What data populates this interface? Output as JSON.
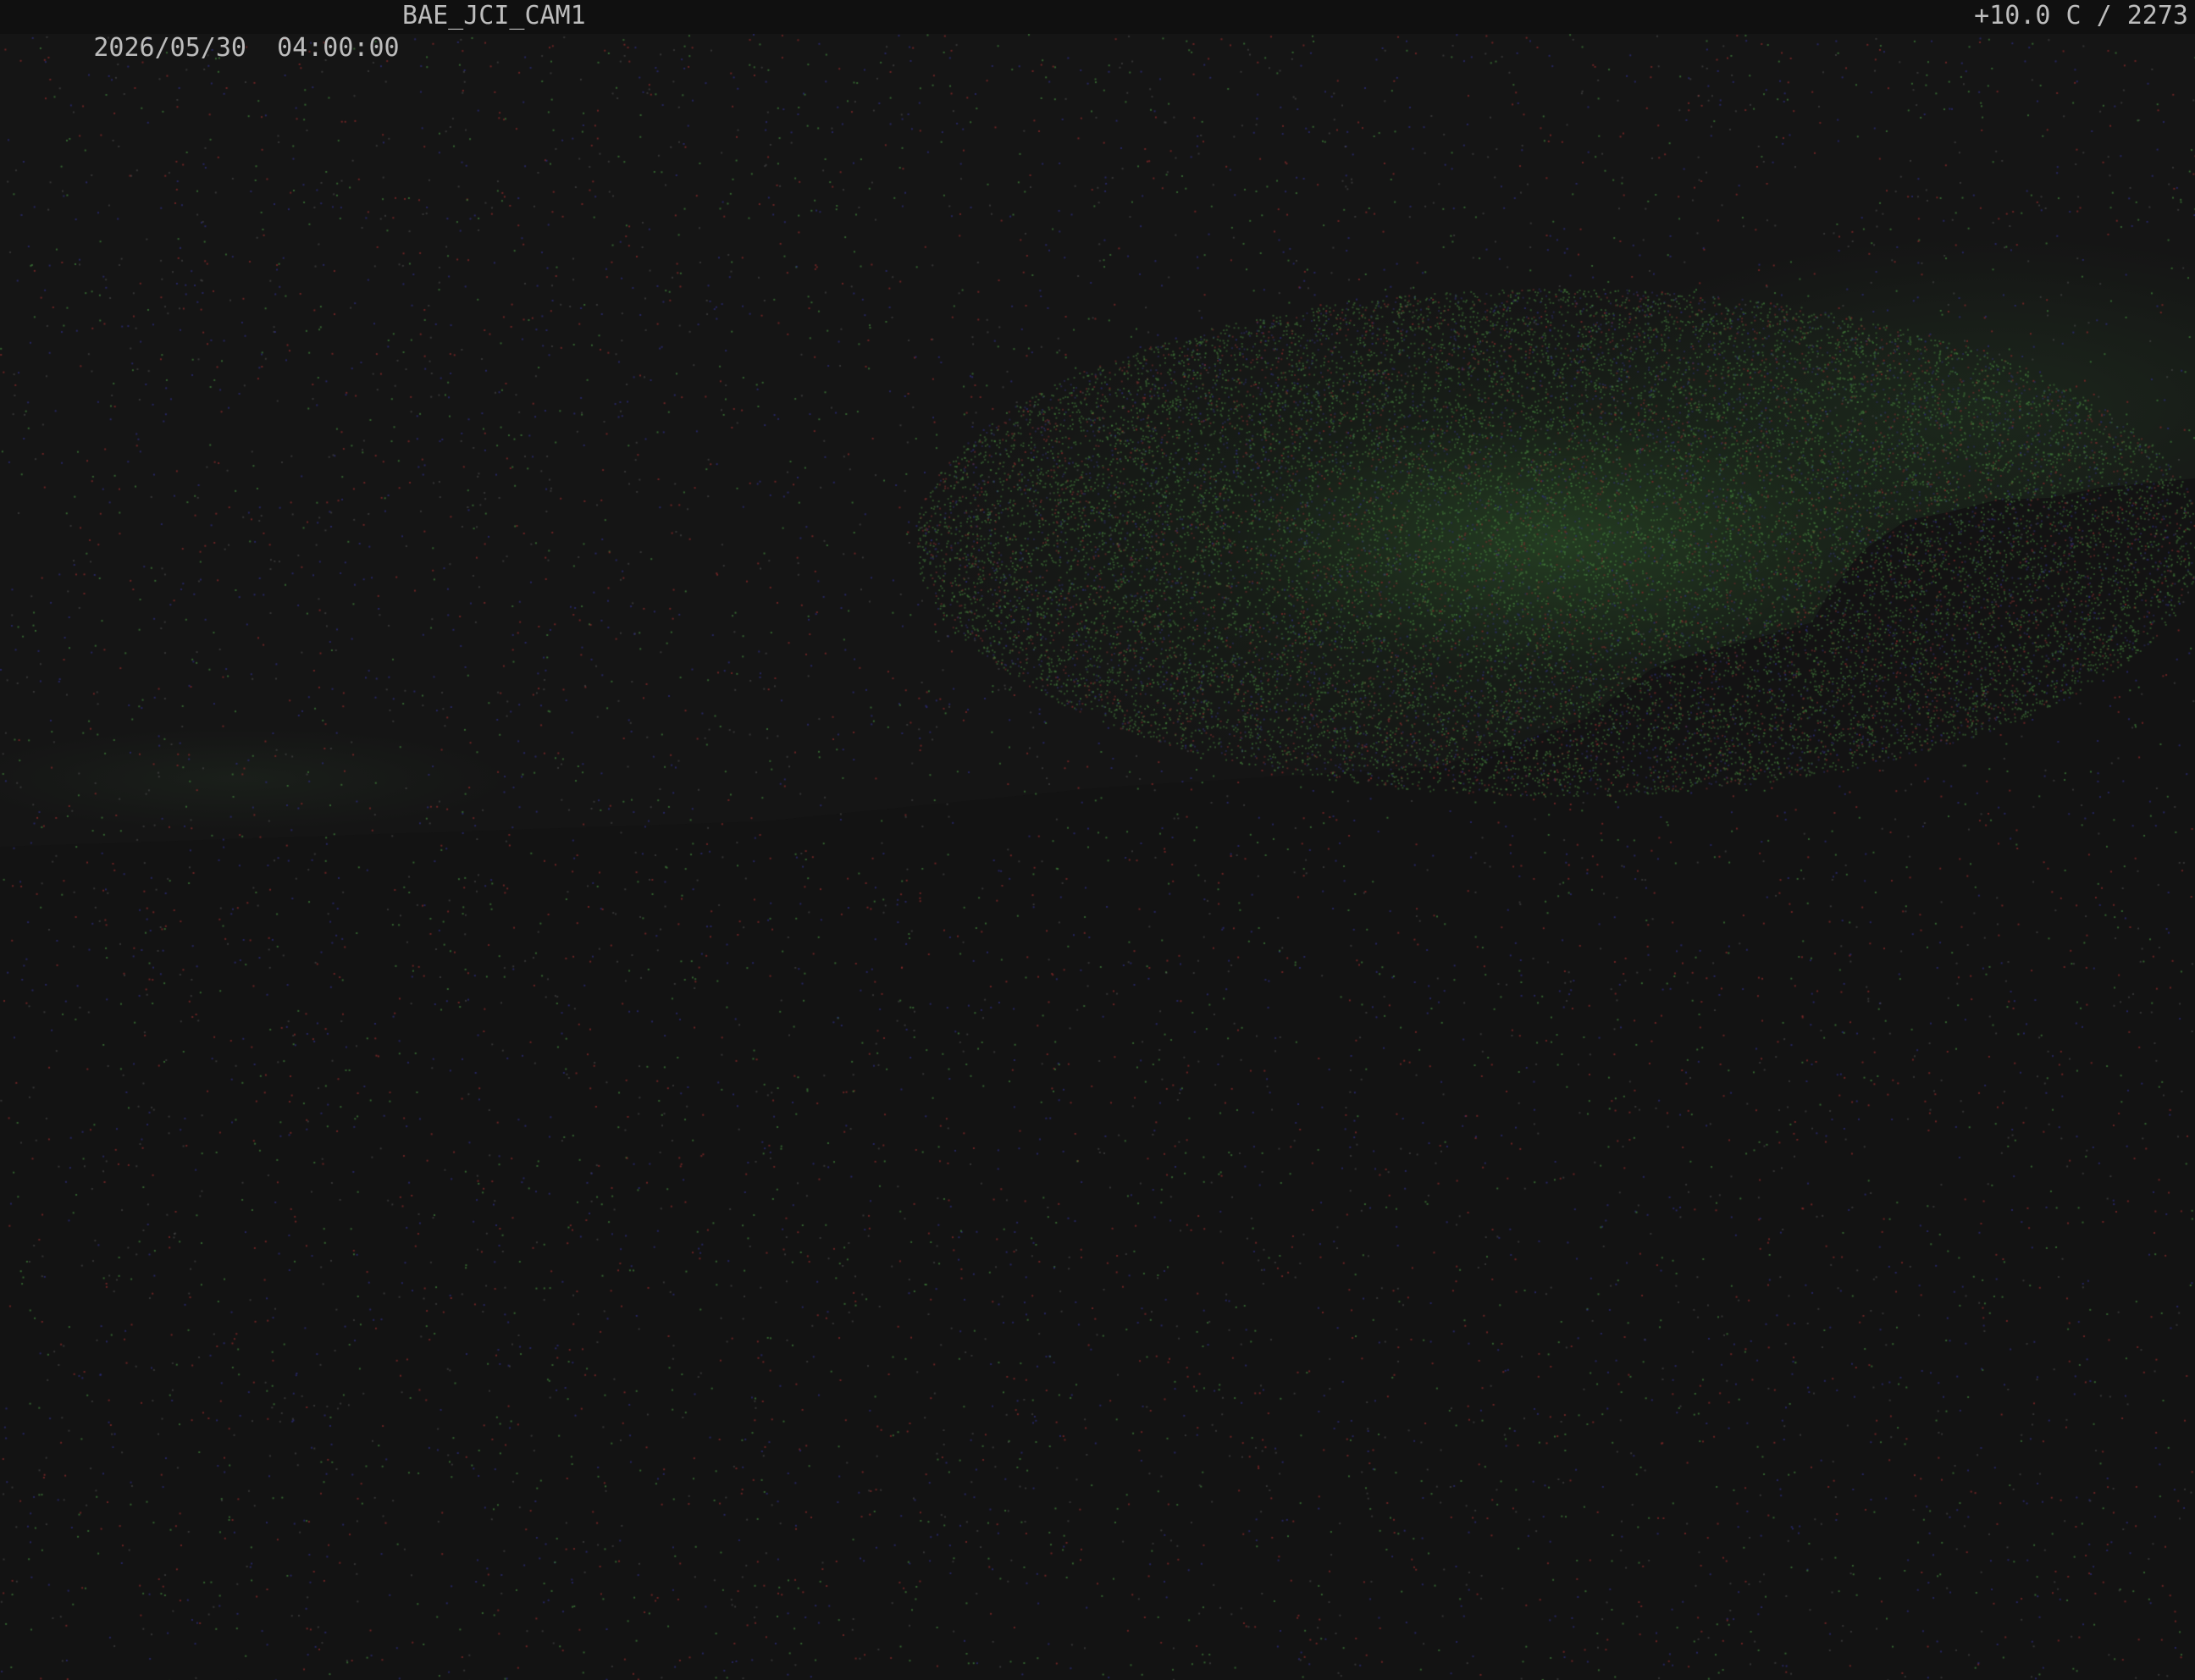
{
  "overlay": {
    "date": "2026/05/30",
    "time": "04:00:00",
    "camera_id": "BAE_JCI_CAM1",
    "readout": "+10.0 C / 2273"
  },
  "scene": {
    "description_colors": {
      "background": "#151515",
      "mountain": "#121212",
      "glow": "#2f5c2c",
      "noise_red": "#7a2626",
      "noise_green": "#3b7a34",
      "noise_blue": "#2a2a7a"
    }
  }
}
